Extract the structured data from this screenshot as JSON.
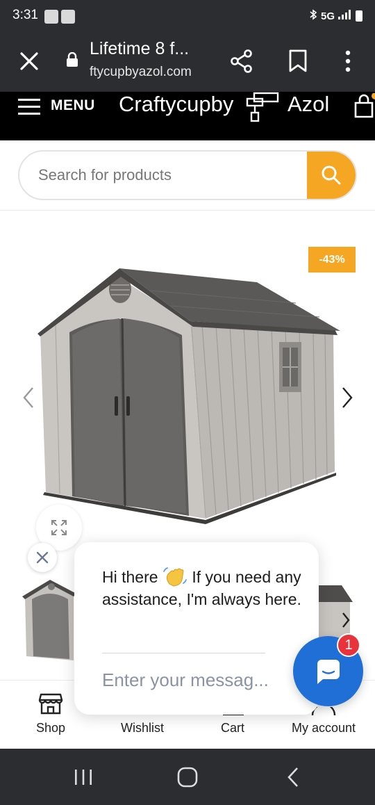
{
  "status_bar": {
    "time": "3:31",
    "network": "5G"
  },
  "browser": {
    "tab_title": "Lifetime 8 f...",
    "url": "ftycupbyazol.com"
  },
  "site_header": {
    "menu_label": "MENU",
    "brand_left": "Craftycupby",
    "brand_right": "Azol"
  },
  "search": {
    "placeholder": "Search for products"
  },
  "product": {
    "discount_badge": "-43%"
  },
  "chat": {
    "greeting_part1": "Hi there",
    "greeting_part2": " If you need any assistance, I'm always here.",
    "input_placeholder": "Enter your messag...",
    "unread_count": "1"
  },
  "bottom_nav": {
    "items": [
      {
        "label": "Shop",
        "icon": "store-icon"
      },
      {
        "label": "Wishlist",
        "icon": "heart-icon"
      },
      {
        "label": "Cart",
        "icon": "cart-icon"
      },
      {
        "label": "My account",
        "icon": "user-icon"
      }
    ]
  },
  "colors": {
    "accent": "#f5a623",
    "chat_blue": "#1f6fd6",
    "badge_red": "#e8323c",
    "header_black": "#000000",
    "chrome_gray": "#2b2d31"
  }
}
